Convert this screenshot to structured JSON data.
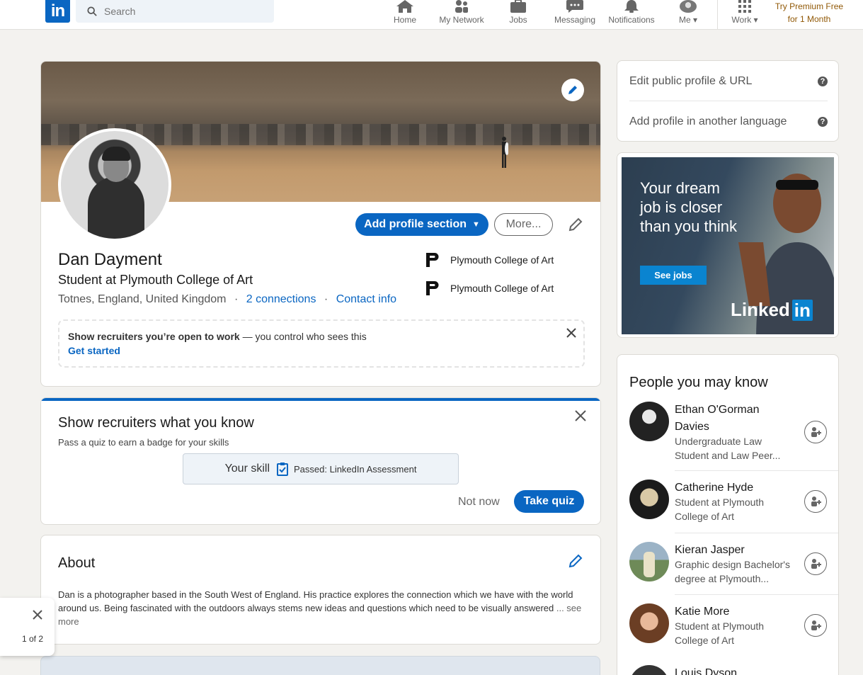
{
  "nav": {
    "logo": "in",
    "search_placeholder": "Search",
    "items": [
      {
        "label": "Home",
        "icon": "home-icon"
      },
      {
        "label": "My Network",
        "icon": "network-icon"
      },
      {
        "label": "Jobs",
        "icon": "briefcase-icon"
      },
      {
        "label": "Messaging",
        "icon": "message-icon"
      },
      {
        "label": "Notifications",
        "icon": "bell-icon"
      },
      {
        "label": "Me",
        "icon": "avatar"
      },
      {
        "label": "Work",
        "icon": "grid-icon"
      }
    ],
    "premium_line1": "Try Premium Free",
    "premium_line2": "for 1 Month"
  },
  "profile": {
    "name": "Dan Dayment",
    "headline": "Student at Plymouth College of Art",
    "location": "Totnes, England, United Kingdom",
    "separator": "·",
    "connections": "2 connections",
    "contact_info": "Contact info",
    "add_section_label": "Add profile section",
    "more_label": "More...",
    "education": [
      {
        "school": "Plymouth College of Art"
      },
      {
        "school": "Plymouth College of Art"
      }
    ],
    "open_to_work": {
      "bold": "Show recruiters you’re open to work",
      "rest": " — you control who sees this",
      "link": "Get started"
    }
  },
  "skills_card": {
    "title": "Show recruiters what you know",
    "subtitle": "Pass a quiz to earn a badge for your skills",
    "your_skill": "Your skill",
    "passed": "Passed: LinkedIn Assessment",
    "not_now": "Not now",
    "take_quiz": "Take quiz"
  },
  "about": {
    "title": "About",
    "text": "Dan is a photographer based in the South West of England. His practice explores the connection which we have with the world around us. Being fascinated with the outdoors always stems new ideas and questions which need to be visually answered",
    "see_more": " ... see more"
  },
  "sidebar": {
    "edit_public": "Edit public profile & URL",
    "add_language": "Add profile in another language",
    "help_glyph": "?"
  },
  "ad": {
    "headline": "Your dream job is closer than you think",
    "button": "See jobs",
    "brand_text": "Linked",
    "brand_in": "in"
  },
  "pymk": {
    "title": "People you may know",
    "people": [
      {
        "name": "Ethan O'Gorman Davies",
        "desc": "Undergraduate Law Student and Law Peer..."
      },
      {
        "name": "Catherine Hyde",
        "desc": "Student at Plymouth College of Art"
      },
      {
        "name": "Kieran Jasper",
        "desc": "Graphic design Bachelor's degree at Plymouth..."
      },
      {
        "name": "Katie More",
        "desc": "Student at Plymouth College of Art"
      },
      {
        "name": "Louis Dyson",
        "desc": ""
      }
    ]
  },
  "toast": {
    "count": "1 of 2"
  }
}
